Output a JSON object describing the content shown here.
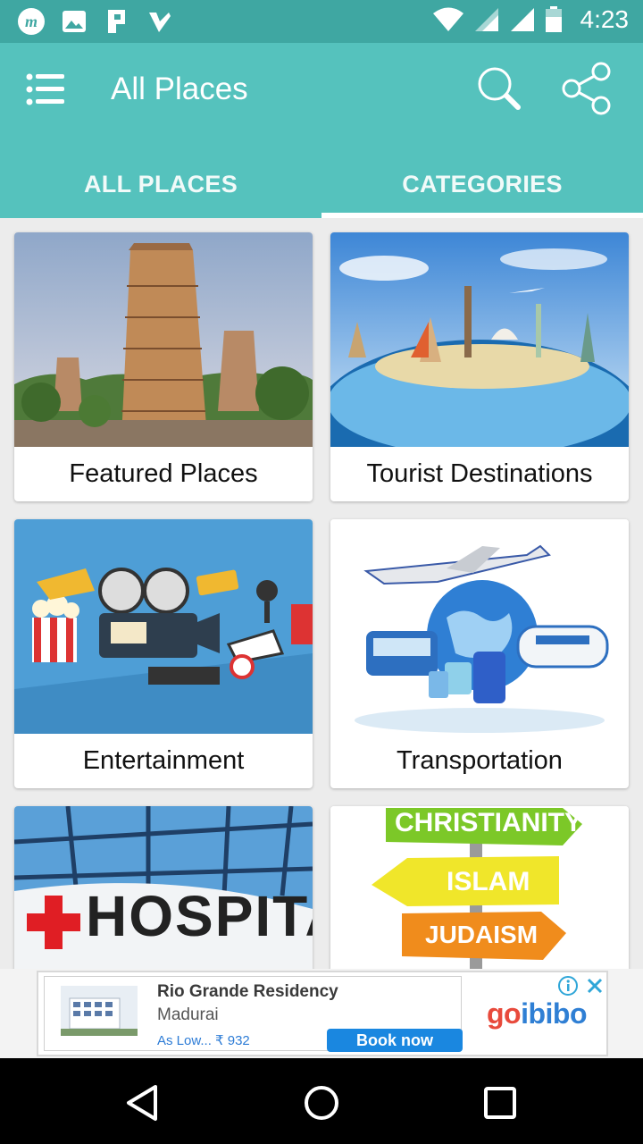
{
  "status_bar": {
    "time": "4:23",
    "left_icons": [
      "m-app-icon",
      "image-icon",
      "parking-app-icon",
      "check-app-icon"
    ],
    "right_icons": [
      "wifi-icon",
      "signal-icon",
      "signal-icon",
      "battery-icon"
    ]
  },
  "app_bar": {
    "title": "All Places",
    "icons": [
      "menu-icon",
      "search-icon",
      "share-icon"
    ]
  },
  "tabs": [
    {
      "label": "ALL PLACES",
      "selected": false
    },
    {
      "label": "CATEGORIES",
      "selected": true
    }
  ],
  "cards": [
    {
      "label": "Featured Places"
    },
    {
      "label": "Tourist Destinations"
    },
    {
      "label": "Entertainment"
    },
    {
      "label": "Transportation"
    },
    {
      "label": "",
      "image_text": "HOSPITA"
    },
    {
      "label": "",
      "image_text": [
        "CHRISTIANITY",
        "ISLAM",
        "JUDAISM"
      ]
    }
  ],
  "ad": {
    "title": "Rio Grande Residency",
    "subtitle": "Madurai",
    "price": "As Low... ₹ 932",
    "button": "Book now",
    "brand_go": "go",
    "brand_ibibo": "ibibo"
  },
  "nav_bar": {
    "buttons": [
      "back-icon",
      "home-icon",
      "recents-icon"
    ]
  },
  "colors": {
    "status_bar": "#3fa7a2",
    "app_bar": "#55c2bd",
    "book_button": "#1a87e0"
  }
}
